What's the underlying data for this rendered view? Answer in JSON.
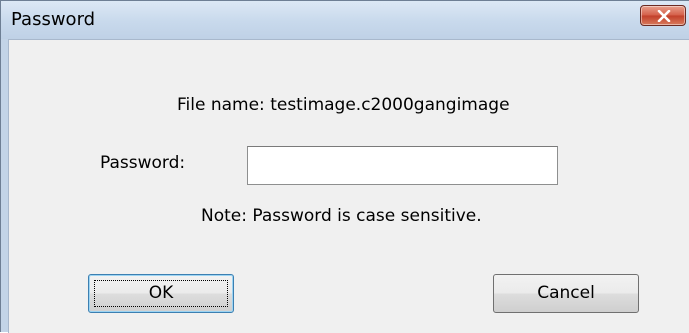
{
  "window": {
    "title": "Password",
    "close_icon": "close-icon"
  },
  "dialog": {
    "file_name_text": "File name: testimage.c2000gangimage",
    "password_label": "Password:",
    "password_value": "",
    "note_text": "Note: Password is case sensitive."
  },
  "buttons": {
    "ok_label": "OK",
    "cancel_label": "Cancel"
  },
  "colors": {
    "close_button": "#c2402a",
    "title_bar": "#c8d9ec",
    "client_background": "#f0f0f0"
  }
}
